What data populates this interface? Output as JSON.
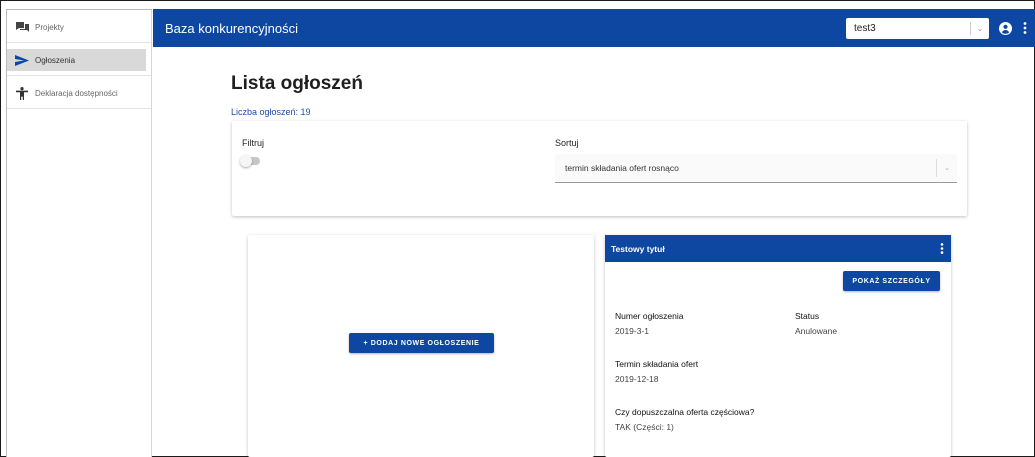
{
  "sidebar": {
    "items": [
      {
        "label": "Projekty",
        "icon": "forum-icon",
        "active": false
      },
      {
        "label": "Ogłoszenia",
        "icon": "send-icon",
        "active": true
      },
      {
        "label": "Deklaracja dostępności",
        "icon": "accessibility-icon",
        "active": false
      }
    ]
  },
  "header": {
    "title": "Baza konkurencyjności",
    "user_select_value": "test3",
    "icons": [
      "account-circle-icon",
      "more-vert-icon"
    ],
    "color": "#0d47a1"
  },
  "main": {
    "title": "Lista ogłoszeń",
    "count_text": "Liczba ogłoszeń: 19",
    "filter_label": "Filtruj",
    "filter_enabled": false,
    "sort_label": "Sortuj",
    "sort_value": "termin składania ofert rosnąco",
    "add_button_label": "+ DODAJ NOWE OGŁOSZENIE"
  },
  "announcement": {
    "title": "Testowy tytuł",
    "details_button_label": "POKAŻ SZCZEGÓŁY",
    "number_label": "Numer ogłoszenia",
    "number_value": "2019-3-1",
    "status_label": "Status",
    "status_value": "Anulowane",
    "deadline_label": "Termin składania ofert",
    "deadline_value": "2019-12-18",
    "partial_label": "Czy dopuszczalna oferta częściowa?",
    "partial_value": "TAK (Części: 1)"
  }
}
